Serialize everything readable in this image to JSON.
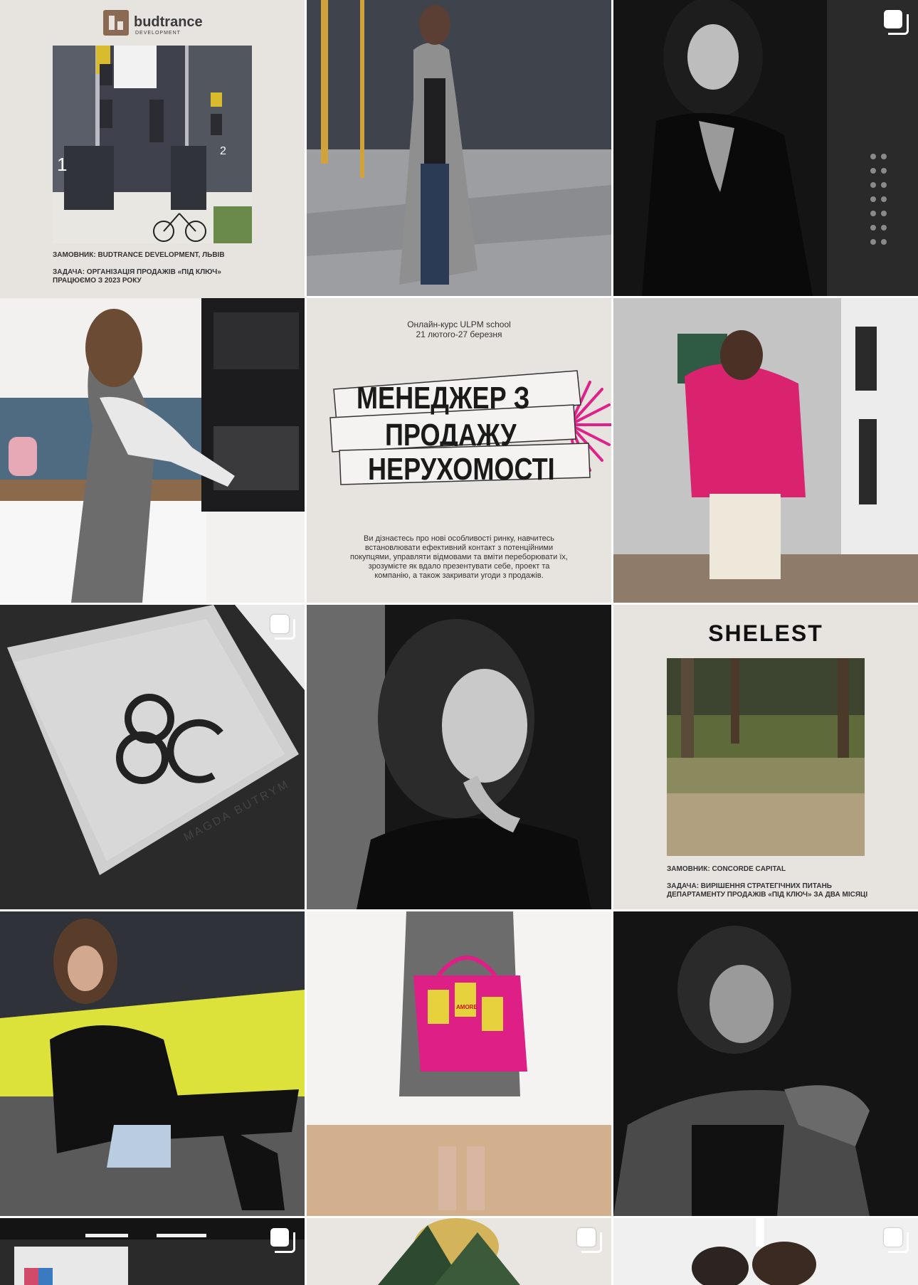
{
  "posts": [
    {
      "id_label": "budtrance",
      "brand": "budtrance",
      "brand_sub": "DEVELOPMENT",
      "client_line": "ЗАМОВНИК: BUDTRANCE DEVELOPMENT, ЛЬВІВ",
      "task_line": "ЗАДАЧА: ОРГАНІЗАЦІЯ ПРОДАЖІВ «ПІД КЛЮЧ»",
      "since_line": "ПРАЦЮЄМО З 2023 РОКУ",
      "entrance_1": "1",
      "entrance_2": "2"
    },
    {
      "multi": false
    },
    {
      "multi": true
    },
    {
      "multi": false
    },
    {
      "course_line1": "Онлайн-курс ULPM school",
      "course_line2": "21 лютого-27 березня",
      "title_line1": "МЕНЕДЖЕР З",
      "title_line2": "ПРОДАЖУ",
      "title_line3": "НЕРУХОМОСТІ",
      "description": "Ви дізнаєтесь про нові особливості ринку, навчитесь встановлювати ефективний контакт з потенційними покупцями, управляти відмовами та вміти переборювати їх, зрозумієте як вдало презентувати себе, проект та компанію, а також закривати угоди з продажів."
    },
    {
      "multi": false
    },
    {
      "multi": true,
      "brand_text": "MAGDA BUTRYM"
    },
    {
      "multi": false
    },
    {
      "brand": "SHELEST",
      "client_line": "ЗАМОВНИК: CONCORDE CAPITAL",
      "task_line1": "ЗАДАЧА: ВИРІШЕННЯ СТРАТЕГІЧНИХ ПИТАНЬ",
      "task_line2": "ДЕПАРТАМЕНТУ ПРОДАЖІВ «ПІД КЛЮЧ» ЗА ДВА МІСЯЦІ"
    },
    {
      "multi": false
    },
    {
      "multi": false,
      "bag_label": "AMORE"
    },
    {
      "multi": false
    },
    {
      "multi": true
    },
    {
      "multi": true
    },
    {
      "multi": true
    }
  ],
  "colors": {
    "beige_bg": "#e7e4df",
    "accent_pink": "#e0218a",
    "brand_brown": "#8a6a55"
  }
}
